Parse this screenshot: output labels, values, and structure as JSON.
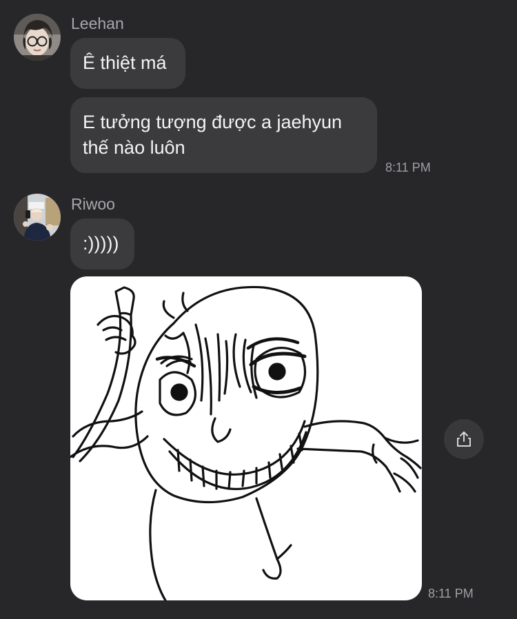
{
  "messages": [
    {
      "sender": "Leehan",
      "avatar_icon": "person-with-glasses-avatar",
      "bubbles": [
        "Ê thiệt má",
        "E tưởng tượng được a jaehyun\nthế nào luôn"
      ],
      "time": "8:11 PM"
    },
    {
      "sender": "Riwoo",
      "avatar_icon": "person-selfie-avatar",
      "bubbles": [
        ":)))))"
      ],
      "image": "creepy-grinning-face-drawing-holding-knife",
      "time": "8:11 PM"
    }
  ],
  "actions": {
    "share_icon": "share-icon"
  },
  "colors": {
    "background": "#27272a",
    "bubble": "#3b3b3e",
    "text": "#f4f4f4",
    "meta_text": "#a0a0a4"
  }
}
